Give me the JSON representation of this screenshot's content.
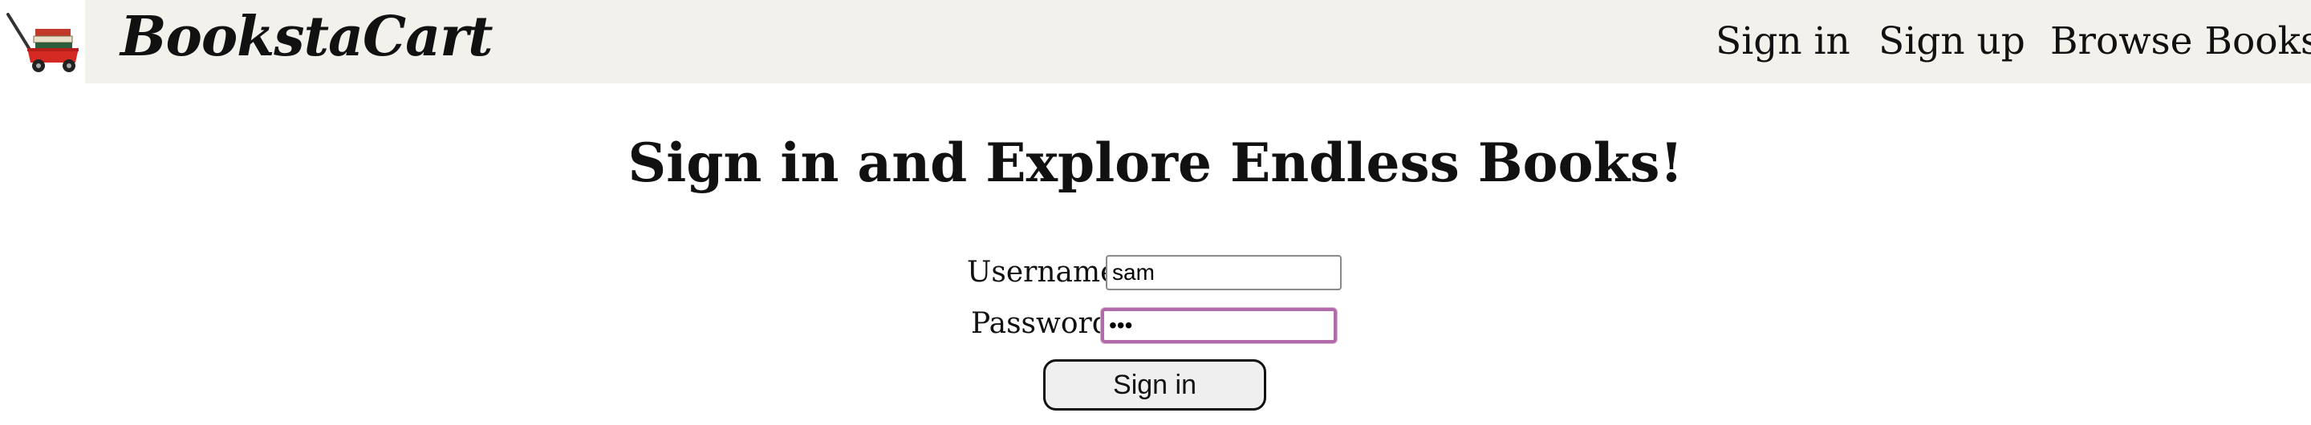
{
  "brand": {
    "name": "BookstaCart",
    "logo_icon": "wagon-with-books-icon"
  },
  "nav": {
    "signin": "Sign in",
    "signup": "Sign up",
    "browse": "Browse Books"
  },
  "main": {
    "heading": "Sign in and Explore Endless Books!",
    "username_label": "Username:",
    "username_value": "sam",
    "password_label": "Password:",
    "password_value": "abc",
    "submit_label": "Sign in"
  },
  "colors": {
    "navbar_bg": "#f3f1eb",
    "focus_border": "#b26aa8",
    "wagon_red": "#d42a23"
  }
}
